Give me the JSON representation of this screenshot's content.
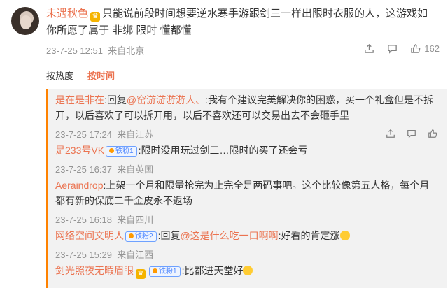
{
  "post": {
    "username": "未遇秋色",
    "text": "只能说前段时间想要逆水寒手游跟剑三一样出限时衣服的人，这游戏如你所愿了属于 非绑 限时 懂都懂",
    "date": "23-7-25 12:51",
    "location": "来自北京",
    "like_count": "162"
  },
  "sort": {
    "tab1": "按热度",
    "tab2": "按时间"
  },
  "replies": [
    {
      "username": "是在是非在",
      "prefix": ":回复",
      "mention": "@窑游游游游人、",
      "text": ":我有个建议完美解决你的困惑，买一个礼盒但是不拆开，以后喜欢了可以拆开用，以后不喜欢还可以交易出去不会砸手里",
      "date": "23-7-25 17:24",
      "location": "来自江苏"
    },
    {
      "username": "是233号VK",
      "badge": "铁粉1",
      "text": ":限时没用玩过剑三…限时的买了还会亏",
      "date": "23-7-25 16:37",
      "location": "来自英国"
    },
    {
      "username": "Aeraindrop",
      "text": ":上架一个月和限量抢完为止完全是两码事吧。这个比较像第五人格，每个月都有新的保底二千金皮永不返场",
      "date": "23-7-25 16:18",
      "location": "来自四川"
    },
    {
      "username": "网络空间文明人",
      "badge": "铁粉2",
      "prefix": ":回复",
      "mention": "@这是什么吃一口啊啊",
      "text": ":好看的肯定涨",
      "date": "23-7-25 15:29",
      "location": "来自江西"
    },
    {
      "username": "剑光照夜无暇眉眼",
      "badge": "铁粉1",
      "text": ":比都进天堂好"
    }
  ],
  "colors": {
    "accent": "#eb7350",
    "reply_bg": "#f2f2f2",
    "reply_border": "#ff8200",
    "meta": "#939393"
  }
}
